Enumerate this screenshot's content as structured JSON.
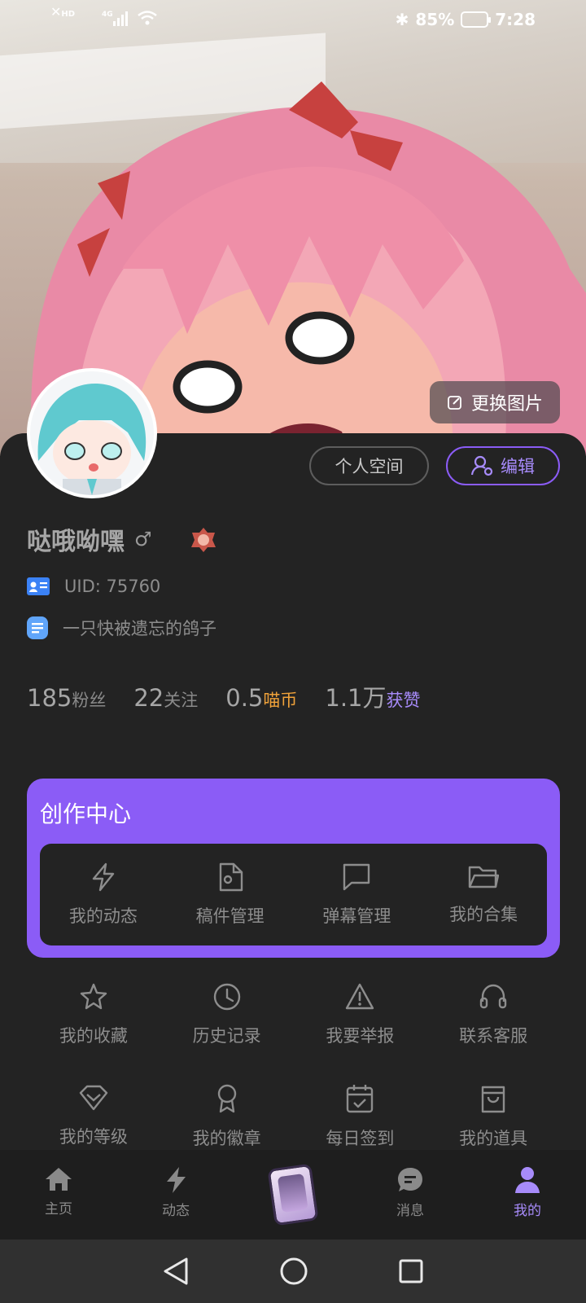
{
  "status_bar": {
    "hd_label": "HD",
    "network": "4G",
    "battery": "85%",
    "time": "7:28"
  },
  "banner": {
    "change_image_label": "更换图片"
  },
  "profile": {
    "space_button": "个人空间",
    "edit_button": "编辑",
    "name": "哒哦呦嘿",
    "gender_symbol": "♂",
    "uid": "UID: 75760",
    "bio": "一只快被遗忘的鸽子"
  },
  "stats": [
    {
      "value": "185",
      "label": "粉丝",
      "color": "gray"
    },
    {
      "value": "22",
      "label": "关注",
      "color": "gray"
    },
    {
      "value": "0.5",
      "label": "喵币",
      "color": "orange"
    },
    {
      "value": "1.1万",
      "label": "获赞",
      "color": "purple"
    }
  ],
  "creator_center": {
    "title": "创作中心",
    "items": [
      {
        "label": "我的动态",
        "icon": "lightning-icon"
      },
      {
        "label": "稿件管理",
        "icon": "file-gear-icon"
      },
      {
        "label": "弹幕管理",
        "icon": "chat-bubble-icon"
      },
      {
        "label": "我的合集",
        "icon": "folder-icon"
      }
    ]
  },
  "grid_row1": [
    {
      "label": "我的收藏",
      "icon": "star-icon"
    },
    {
      "label": "历史记录",
      "icon": "history-clock-icon"
    },
    {
      "label": "我要举报",
      "icon": "warning-icon"
    },
    {
      "label": "联系客服",
      "icon": "headset-icon"
    }
  ],
  "grid_row2": [
    {
      "label": "我的等级",
      "icon": "diamond-icon"
    },
    {
      "label": "我的徽章",
      "icon": "medal-icon"
    },
    {
      "label": "每日签到",
      "icon": "calendar-check-icon"
    },
    {
      "label": "我的道具",
      "icon": "bag-icon"
    }
  ],
  "bottom_nav": [
    {
      "label": "主页",
      "icon": "home-icon"
    },
    {
      "label": "动态",
      "icon": "lightning-icon"
    },
    {
      "label": "消息",
      "icon": "message-icon"
    },
    {
      "label": "我的",
      "icon": "user-icon",
      "active": true
    }
  ],
  "colors": {
    "accent": "#8b5cf6",
    "background": "#232323",
    "coin": "#f0a23a"
  }
}
